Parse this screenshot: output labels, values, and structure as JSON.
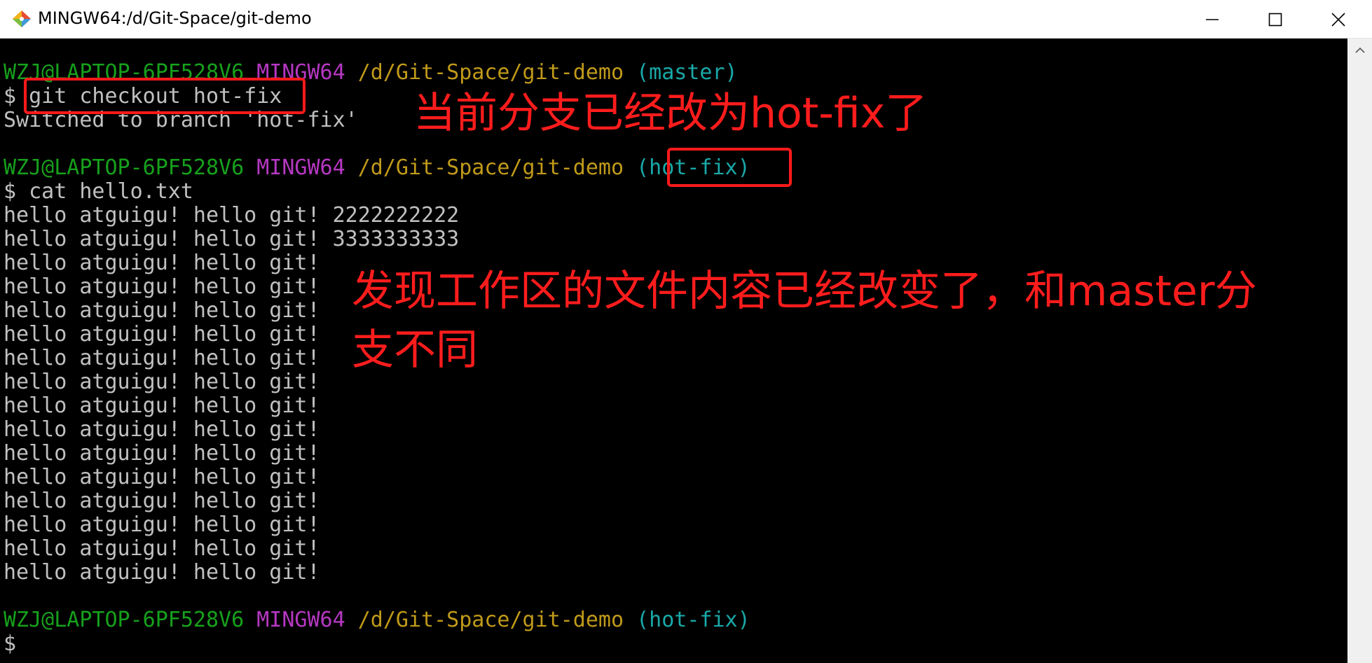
{
  "window": {
    "title": "MINGW64:/d/Git-Space/git-demo",
    "icon": "git-diamond-icon",
    "controls": [
      "minimize-icon",
      "maximize-icon",
      "close-icon"
    ]
  },
  "colors": {
    "user": "#17a01c",
    "msys": "#b538c2",
    "path": "#c09a1a",
    "branch": "#1aa8a8",
    "output": "#c0c0c0",
    "annotation": "#ff1c1c"
  },
  "terminal": {
    "prompt1": {
      "user": "WZJ@LAPTOP-6PF528V6",
      "msys": "MINGW64",
      "path": "/d/Git-Space/git-demo",
      "branch": "(master)"
    },
    "cmd1": "$ git checkout hot-fix",
    "out1": "Switched to branch 'hot-fix'",
    "prompt2": {
      "user": "WZJ@LAPTOP-6PF528V6",
      "msys": "MINGW64",
      "path": "/d/Git-Space/git-demo",
      "branch": "(hot-fix)"
    },
    "cmd2": "$ cat hello.txt",
    "file_lines": [
      "hello atguigu! hello git! 2222222222",
      "hello atguigu! hello git! 3333333333",
      "hello atguigu! hello git!",
      "hello atguigu! hello git!",
      "hello atguigu! hello git!",
      "hello atguigu! hello git!",
      "hello atguigu! hello git!",
      "hello atguigu! hello git!",
      "hello atguigu! hello git!",
      "hello atguigu! hello git!",
      "hello atguigu! hello git!",
      "hello atguigu! hello git!",
      "hello atguigu! hello git!",
      "hello atguigu! hello git!",
      "hello atguigu! hello git!",
      "hello atguigu! hello git!"
    ],
    "prompt3": {
      "user": "WZJ@LAPTOP-6PF528V6",
      "msys": "MINGW64",
      "path": "/d/Git-Space/git-demo",
      "branch": "(hot-fix)"
    },
    "cmd3": "$"
  },
  "annotations": {
    "note1": "当前分支已经改为hot-fix了",
    "note2_line1": "发现工作区的文件内容已经改变了，和master分",
    "note2_line2": "支不同"
  }
}
